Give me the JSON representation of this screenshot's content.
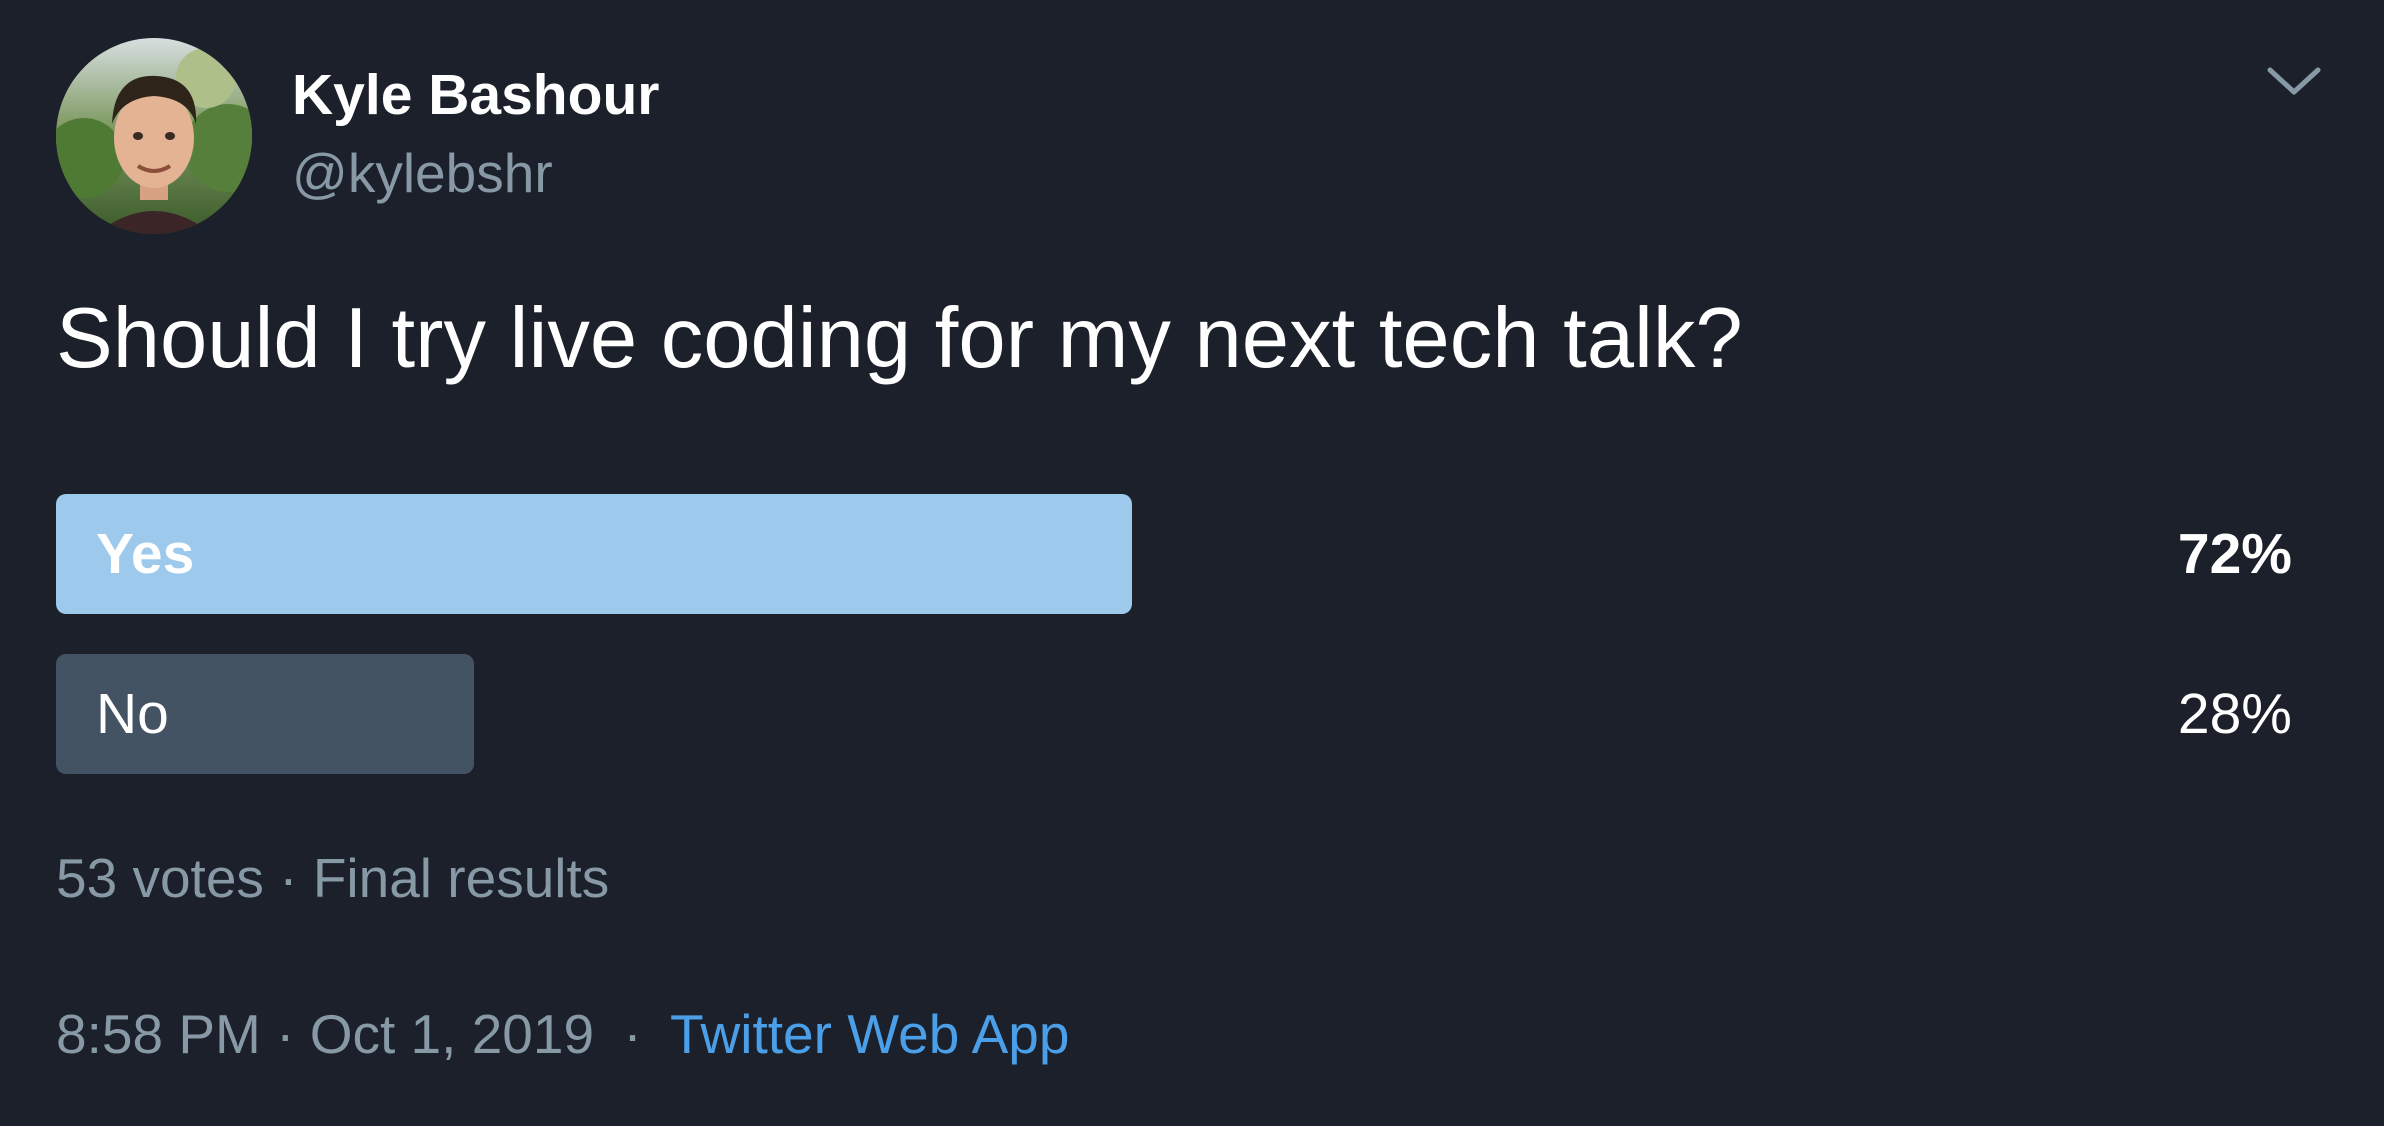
{
  "author": {
    "name": "Kyle Bashour",
    "handle": "@kylebshr"
  },
  "tweet": {
    "text": "Should I try live coding for my next tech talk?"
  },
  "poll": {
    "options": [
      {
        "label": "Yes",
        "percent_text": "72%",
        "percent": 72,
        "winner": true
      },
      {
        "label": "No",
        "percent_text": "28%",
        "percent": 28,
        "winner": false
      }
    ],
    "votes": "53 votes",
    "meta_separator": "·",
    "status": "Final results"
  },
  "footer": {
    "time": "8:58 PM",
    "separator": "·",
    "date": "Oct 1, 2019",
    "source": "Twitter Web App"
  },
  "colors": {
    "background": "#1b202a",
    "winner_bar": "#9cc9ec",
    "other_bar": "#435363",
    "secondary_text": "#8899a6",
    "link": "#4a9fe8"
  },
  "icons": {
    "more": "chevron-down-icon"
  }
}
